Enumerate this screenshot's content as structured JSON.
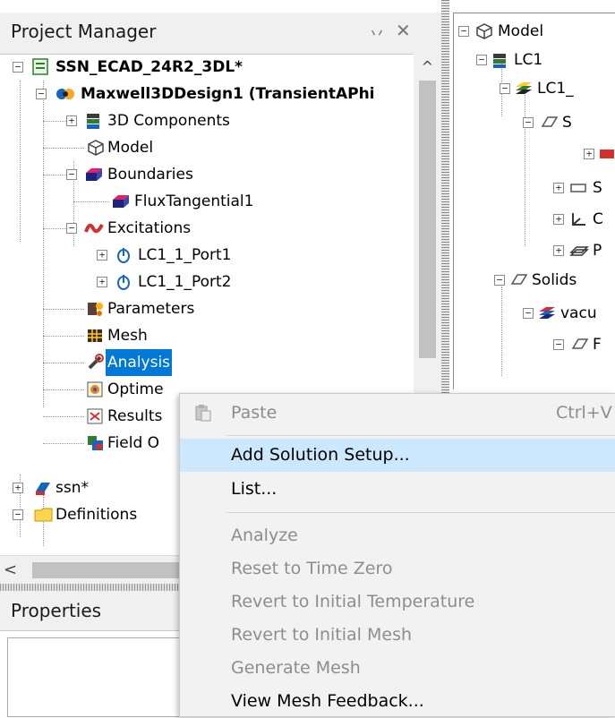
{
  "project_manager": {
    "title": "Project Manager",
    "pin_glyph": "丷",
    "close_glyph": "✕",
    "tree": {
      "project": "SSN_ECAD_24R2_3DL*",
      "design": "Maxwell3DDesign1 (TransientAPhi",
      "components": "3D Components",
      "model": "Model",
      "boundaries": "Boundaries",
      "flux": "FluxTangential1",
      "excitations": "Excitations",
      "port1": "LC1_1_Port1",
      "port2": "LC1_1_Port2",
      "parameters": "Parameters",
      "mesh": "Mesh",
      "analysis": "Analysis",
      "optimetrics": "Optime",
      "results": "Results",
      "field": "Field O",
      "ssn": "ssn*",
      "definitions": "Definitions"
    }
  },
  "properties": {
    "title": "Properties"
  },
  "model_tree": {
    "model": "Model",
    "lc1": "LC1",
    "lc1_sub": "LC1_",
    "s1": "S",
    "s2": "S",
    "c": "C",
    "p": "P",
    "solids": "Solids",
    "vacuum": "vacu",
    "f": "F"
  },
  "context_menu": {
    "paste": {
      "label": "Paste",
      "shortcut": "Ctrl+V"
    },
    "add_solution_setup": "Add Solution Setup...",
    "list": "List...",
    "analyze": "Analyze",
    "reset_time_zero": "Reset to Time Zero",
    "revert_temp": "Revert to Initial Temperature",
    "revert_mesh": "Revert to Initial Mesh",
    "generate_mesh": "Generate Mesh",
    "view_mesh_feedback": "View Mesh Feedback..."
  },
  "colors": {
    "selection": "#0078d7",
    "menu_hover": "#cce8ff",
    "disabled_text": "#8d8d8d"
  }
}
